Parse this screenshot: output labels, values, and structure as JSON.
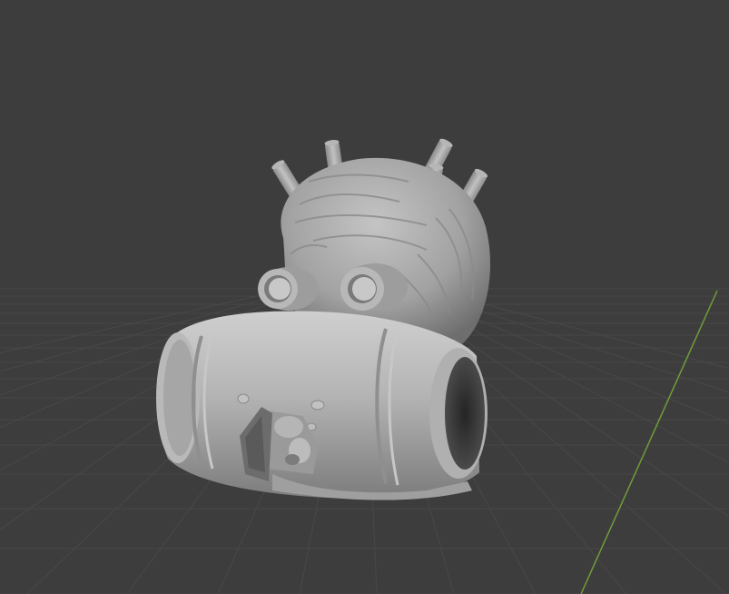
{
  "viewport": {
    "background": "#3d3d3d",
    "grid_line_color": "#4a4a4a",
    "axis_y_color": "#6f9d3a",
    "overlay_text": []
  },
  "scene": {
    "object": "barrel-creature-sculpt",
    "shading": "solid",
    "base_color": "#a9a9a9"
  }
}
